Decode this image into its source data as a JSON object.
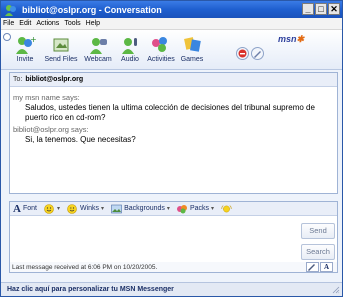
{
  "window": {
    "title": "bibliot@oslpr.org - Conversation"
  },
  "titlebar_buttons": {
    "minimize": "_",
    "maximize": "□",
    "close": "✕"
  },
  "menu": [
    "File",
    "Edit",
    "Actions",
    "Tools",
    "Help"
  ],
  "toolbar": {
    "tools": [
      {
        "label": "Invite",
        "icon": "invite-icon"
      },
      {
        "label": "Send Files",
        "icon": "send-files-icon"
      },
      {
        "label": "Webcam",
        "icon": "webcam-icon"
      },
      {
        "label": "Audio",
        "icon": "audio-icon"
      },
      {
        "label": "Activities",
        "icon": "activities-icon"
      },
      {
        "label": "Games",
        "icon": "games-icon"
      }
    ],
    "logo": "msn"
  },
  "conversation": {
    "to_label": "To:",
    "to_value": "bibliot@oslpr.org",
    "messages": [
      {
        "sender": "my msn name says:",
        "text": "Saludos, ustedes tienen la ultima colección de decisiones del tribunal supremo de puerto rico en cd-rom?"
      },
      {
        "sender": "bibliot@oslpr.org says:",
        "text": "Si, la tenemos. Que necesitas?"
      }
    ]
  },
  "compose": {
    "format_bar": {
      "font": "Font",
      "winks": "Winks",
      "backgrounds": "Backgrounds",
      "packs": "Packs"
    },
    "input_value": "",
    "send": "Send",
    "search": "Search"
  },
  "status": {
    "last_message": "Last message received at 6:06 PM on 10/20/2005.",
    "text_mode": "A"
  },
  "bottom_bar": {
    "text": "Haz clic aquí para personalizar tu MSN Messenger"
  },
  "colors": {
    "titlebar": "#1f5fcf",
    "accent": "#2d3f9c",
    "msn_fly": "#e36b14"
  }
}
